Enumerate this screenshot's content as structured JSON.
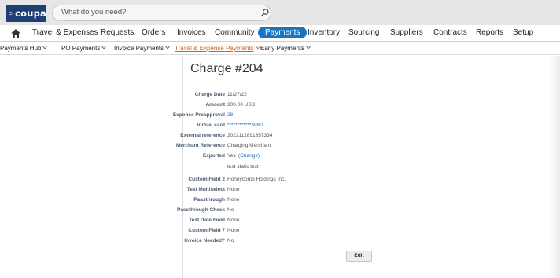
{
  "app": {
    "logo_text": "coupa",
    "search_placeholder": "What do you need?"
  },
  "main_nav": [
    {
      "label": "Travel & Expenses"
    },
    {
      "label": "Requests"
    },
    {
      "label": "Orders"
    },
    {
      "label": "Invoices"
    },
    {
      "label": "Community"
    },
    {
      "label": "Payments",
      "active": true
    },
    {
      "label": "Inventory"
    },
    {
      "label": "Sourcing"
    },
    {
      "label": "Suppliers"
    },
    {
      "label": "Contracts"
    },
    {
      "label": "Reports"
    },
    {
      "label": "Setup"
    }
  ],
  "sub_nav": [
    {
      "label": "Payments Hub"
    },
    {
      "label": "PO Payments"
    },
    {
      "label": "Invoice Payments"
    },
    {
      "label": "Travel & Expense Payments",
      "active": true
    },
    {
      "label": "Early Payments"
    }
  ],
  "charge": {
    "title": "Charge #204",
    "fields": [
      {
        "label": "Charge Date",
        "value": "11/27/22"
      },
      {
        "label": "Amount",
        "value": "200.00 USD"
      },
      {
        "label": "Expense Preapproval",
        "value": "28"
      },
      {
        "label": "Virtual card",
        "value": "************3980"
      },
      {
        "label": "External reference",
        "value": "2022112891357334"
      },
      {
        "label": "Merchant Reference",
        "value": "Charging Merchant"
      },
      {
        "label": "Exported",
        "value": "Yes",
        "extra": "(Change)"
      },
      {
        "label": "",
        "value": "test static text"
      },
      {
        "label": "Custom Field 2",
        "value": "Honeycomb Holdings Inc."
      },
      {
        "label": "Test Multiselect",
        "value": "None"
      },
      {
        "label": "Paasthrough",
        "value": "None"
      },
      {
        "label": "Passthrough Check",
        "value": "No"
      },
      {
        "label": "Test Date Field",
        "value": "None"
      },
      {
        "label": "Custom Field 7",
        "value": "None"
      },
      {
        "label": "Invoice Needed?",
        "value": "No"
      }
    ],
    "edit_label": "Edit"
  },
  "colors": {
    "brand": "#1d3f73",
    "accent": "#1a74c4",
    "active_subnav": "#d4601d"
  },
  "icons": {
    "home": "home-icon",
    "search": "search-icon",
    "dropdown": "chevron-down-icon"
  }
}
